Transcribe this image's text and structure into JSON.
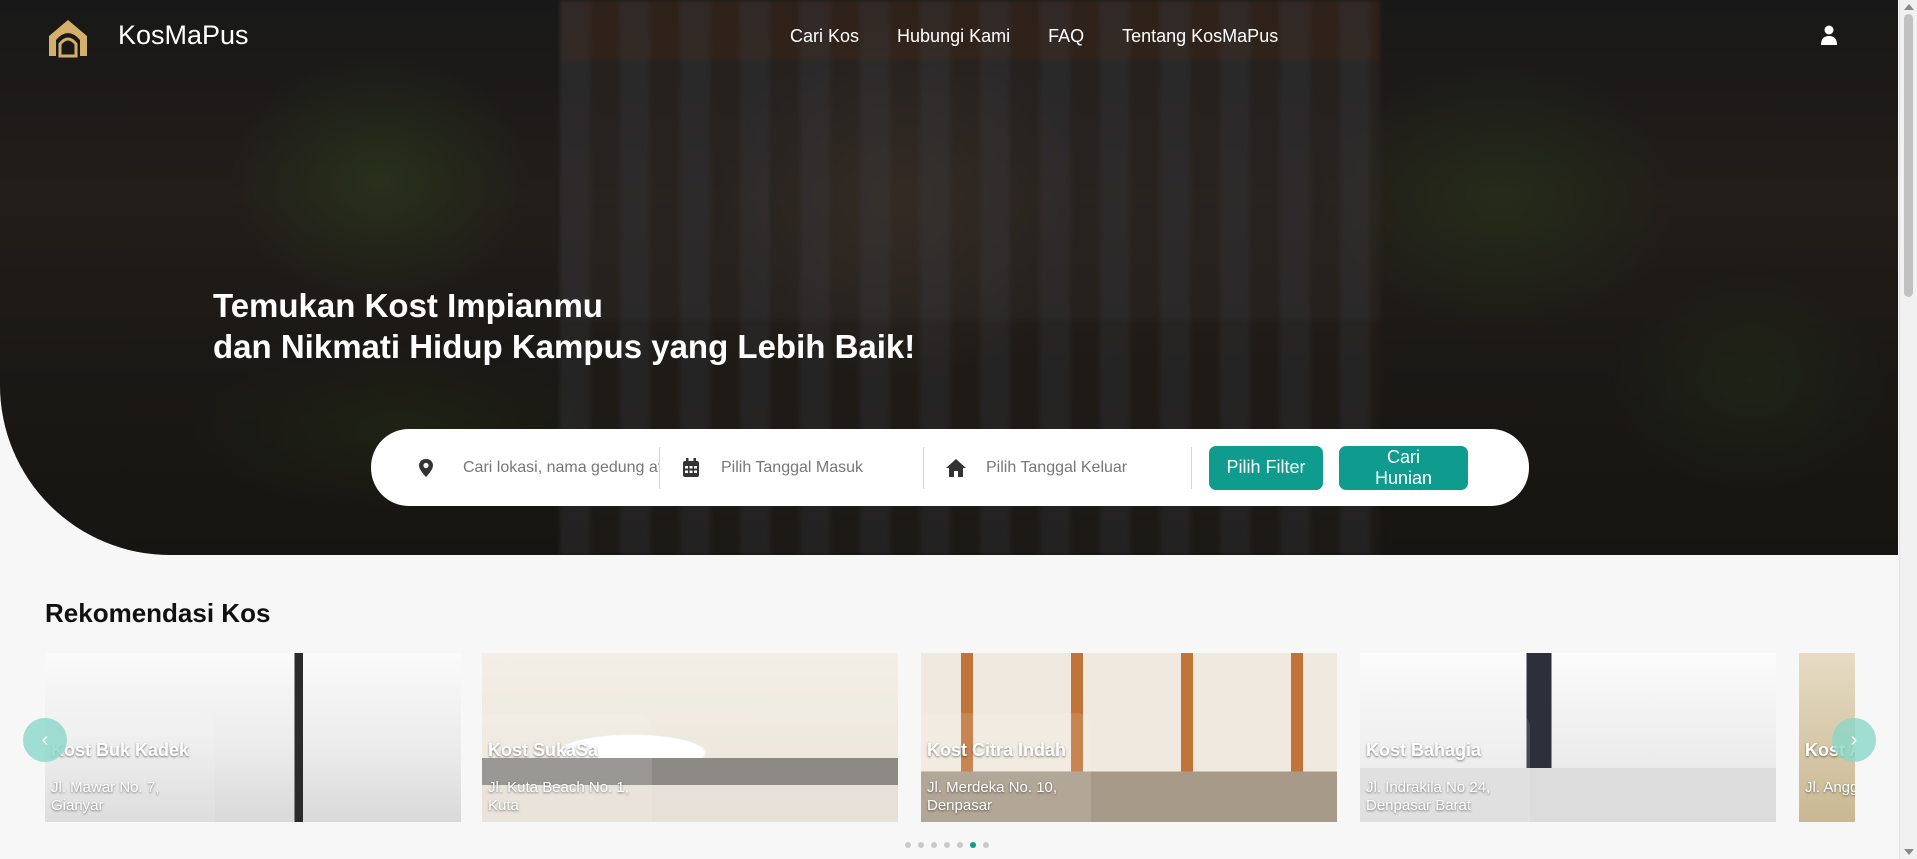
{
  "brand": {
    "name": "KosMaPus",
    "logo_icon": "house-arch-logo-icon",
    "logo_color": "#d4b06a"
  },
  "nav": {
    "items": [
      {
        "label": "Cari Kos"
      },
      {
        "label": "Hubungi Kami"
      },
      {
        "label": "FAQ"
      },
      {
        "label": "Tentang KosMaPus"
      }
    ],
    "user_icon": "user-icon"
  },
  "hero": {
    "headline_line1": "Temukan Kost Impianmu",
    "headline_line2": "dan Nikmati Hidup Kampus yang Lebih Baik!"
  },
  "search": {
    "location_icon": "map-pin-icon",
    "location_placeholder": "Cari lokasi, nama gedung atau alamat",
    "checkin_icon": "calendar-icon",
    "checkin_placeholder": "Pilih Tanggal Masuk",
    "checkout_icon": "home-icon",
    "checkout_placeholder": "Pilih Tanggal Keluar",
    "filter_label": "Pilih Filter",
    "search_label": "Cari Hunian",
    "accent_color": "#0f9b8e"
  },
  "recommendations": {
    "title": "Rekomendasi Kos",
    "cards": [
      {
        "name": "Kost Buk Kadek",
        "address": "Jl. Mawar No. 7, Gianyar"
      },
      {
        "name": "Kost SukaSa",
        "address": "Jl. Kuta Beach No. 1, Kuta"
      },
      {
        "name": "Kost Citra Indah",
        "address": "Jl. Merdeka No. 10, Denpasar"
      },
      {
        "name": "Kost Bahagia",
        "address": "Jl. Indrakila No 24, Denpasar Barat"
      },
      {
        "name": "Kost Anggrek",
        "address": "Jl. Anggrek, Badung"
      }
    ],
    "prev_icon": "chevron-left-icon",
    "next_icon": "chevron-right-icon",
    "dot_count": 7,
    "active_dot": 6
  }
}
